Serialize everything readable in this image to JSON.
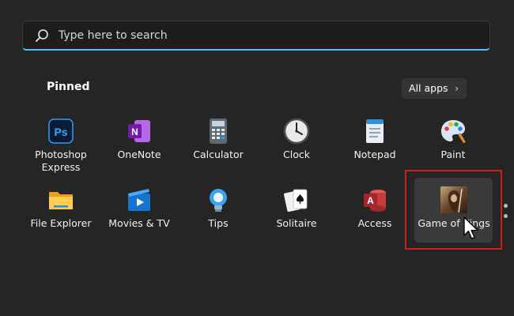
{
  "search": {
    "placeholder": "Type here to search",
    "icon": "search-icon"
  },
  "pinned": {
    "title": "Pinned",
    "all_apps_label": "All apps",
    "apps": [
      {
        "label": "Photoshop Express",
        "icon": "photoshop-express-icon"
      },
      {
        "label": "OneNote",
        "icon": "onenote-icon"
      },
      {
        "label": "Calculator",
        "icon": "calculator-icon"
      },
      {
        "label": "Clock",
        "icon": "clock-icon"
      },
      {
        "label": "Notepad",
        "icon": "notepad-icon"
      },
      {
        "label": "Paint",
        "icon": "paint-icon"
      },
      {
        "label": "File Explorer",
        "icon": "file-explorer-icon"
      },
      {
        "label": "Movies & TV",
        "icon": "movies-tv-icon"
      },
      {
        "label": "Tips",
        "icon": "tips-icon"
      },
      {
        "label": "Solitaire",
        "icon": "solitaire-icon"
      },
      {
        "label": "Access",
        "icon": "access-icon"
      },
      {
        "label": "Game of Kings",
        "icon": "game-of-kings-icon"
      }
    ]
  },
  "colors": {
    "accent": "#4cc2ff",
    "highlight": "#d31c1c",
    "background": "#252525"
  }
}
